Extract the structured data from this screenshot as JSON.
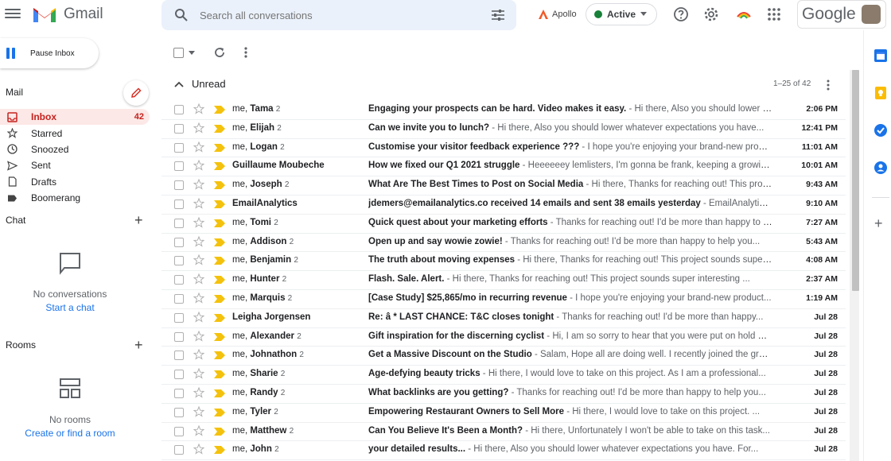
{
  "header": {
    "app_name": "Gmail",
    "search_placeholder": "Search all conversations",
    "apollo_label": "Apollo",
    "status_label": "Active",
    "status_color": "#188038",
    "google_label": "Google"
  },
  "compose": {
    "label": "Pause Inbox"
  },
  "sidebar": {
    "mail_label": "Mail",
    "items": [
      {
        "label": "Inbox",
        "count": "42",
        "icon": "inbox-icon"
      },
      {
        "label": "Starred",
        "count": "",
        "icon": "star-icon"
      },
      {
        "label": "Snoozed",
        "count": "",
        "icon": "clock-icon"
      },
      {
        "label": "Sent",
        "count": "",
        "icon": "send-icon"
      },
      {
        "label": "Drafts",
        "count": "",
        "icon": "draft-icon"
      },
      {
        "label": "Boomerang",
        "count": "",
        "icon": "label-icon"
      }
    ],
    "chat": {
      "title": "Chat",
      "empty_text": "No conversations",
      "link": "Start a chat"
    },
    "rooms": {
      "title": "Rooms",
      "empty_text": "No rooms",
      "link": "Create or find a room"
    }
  },
  "list": {
    "section_title": "Unread",
    "pager": "1–25 of 42",
    "emails": [
      {
        "sender_prefix": "me, ",
        "sender": "Tama",
        "count": "2",
        "subject": "Engaging your prospects can be hard. Video makes it easy.",
        "snippet": " - Hi there, Also you should lower whatever expectations you have...",
        "time": "2:06 PM"
      },
      {
        "sender_prefix": "me, ",
        "sender": "Elijah",
        "count": "2",
        "subject": "Can we invite you to lunch?",
        "snippet": " - Hi there, Also you should lower whatever expectations you have...",
        "time": "12:41 PM"
      },
      {
        "sender_prefix": "me, ",
        "sender": "Logan",
        "count": "2",
        "subject": "Customise your visitor feedback experience ???",
        "snippet": " - I hope you're enjoying your brand-new product...",
        "time": "11:01 AM"
      },
      {
        "sender_prefix": "",
        "sender": "Guillaume Moubeche",
        "count": "",
        "subject": "How we fixed our Q1 2021 struggle",
        "snippet": " - Heeeeeey lemlisters, I'm gonna be frank, keeping a growing...",
        "time": "10:01 AM"
      },
      {
        "sender_prefix": "me, ",
        "sender": "Joseph",
        "count": "2",
        "subject": "What Are The Best Times to Post on Social Media",
        "snippet": " - Hi there, Thanks for reaching out! This project...",
        "time": "9:43 AM"
      },
      {
        "sender_prefix": "",
        "sender": "EmailAnalytics",
        "count": "",
        "subject": "jdemers@emailanalytics.co received 14 emails and sent 38 emails yesterday",
        "snippet": " - EmailAnalytics...",
        "time": "9:10 AM"
      },
      {
        "sender_prefix": "me, ",
        "sender": "Tomi",
        "count": "2",
        "subject": "Quick quest about your marketing efforts",
        "snippet": " - Thanks for reaching out! I'd be more than happy to help...",
        "time": "7:27 AM"
      },
      {
        "sender_prefix": "me, ",
        "sender": "Addison",
        "count": "2",
        "subject": "Open up and say wowie zowie!",
        "snippet": " - Thanks for reaching out! I'd be more than happy to help you...",
        "time": "5:43 AM"
      },
      {
        "sender_prefix": "me, ",
        "sender": "Benjamin",
        "count": "2",
        "subject": "The truth about moving expenses",
        "snippet": " - Hi there, Thanks for reaching out! This project sounds super...",
        "time": "4:08 AM"
      },
      {
        "sender_prefix": "me, ",
        "sender": "Hunter",
        "count": "2",
        "subject": "Flash. Sale. Alert.",
        "snippet": " - Hi there, Thanks for reaching out! This project sounds super interesting ...",
        "time": "2:37 AM"
      },
      {
        "sender_prefix": "me, ",
        "sender": "Marquis",
        "count": "2",
        "subject": "[Case Study] $25,865/mo in recurring revenue",
        "snippet": " - I hope you're enjoying your brand-new product...",
        "time": "1:19 AM"
      },
      {
        "sender_prefix": "",
        "sender": "Leigha Jorgensen",
        "count": "",
        "subject": "Re: â * LAST CHANCE: T&C closes tonight",
        "snippet": " - Thanks for reaching out! I'd be more than happy...",
        "time": "Jul 28"
      },
      {
        "sender_prefix": "me, ",
        "sender": "Alexander",
        "count": "2",
        "subject": "Gift inspiration for the discerning cyclist",
        "snippet": " - Hi, I am so sorry to hear that you were put on hold with...",
        "time": "Jul 28"
      },
      {
        "sender_prefix": "me, ",
        "sender": "Johnathon",
        "count": "2",
        "subject": "Get a Massive Discount on the Studio",
        "snippet": " - Salam, Hope all are doing well. I recently joined the group...",
        "time": "Jul 28"
      },
      {
        "sender_prefix": "me, ",
        "sender": "Sharie",
        "count": "2",
        "subject": "Age-defying beauty tricks",
        "snippet": " - Hi there, I would love to take on this project. As I am a professional...",
        "time": "Jul 28"
      },
      {
        "sender_prefix": "me, ",
        "sender": "Randy",
        "count": "2",
        "subject": "What backlinks are you getting?",
        "snippet": " - Thanks for reaching out! I'd be more than happy to help you...",
        "time": "Jul 28"
      },
      {
        "sender_prefix": "me, ",
        "sender": "Tyler",
        "count": "2",
        "subject": "Empowering Restaurant Owners to Sell More",
        "snippet": " - Hi there, I would love to take on this project. ...",
        "time": "Jul 28"
      },
      {
        "sender_prefix": "me, ",
        "sender": "Matthew",
        "count": "2",
        "subject": "Can You Believe It's Been a Month?",
        "snippet": " - Hi there, Unfortunately I won't be able to take on this task...",
        "time": "Jul 28"
      },
      {
        "sender_prefix": "me, ",
        "sender": "John",
        "count": "2",
        "subject": "your detailed results...",
        "snippet": " - Hi there, Also you should lower whatever expectations you have. For...",
        "time": "Jul 28"
      }
    ]
  }
}
